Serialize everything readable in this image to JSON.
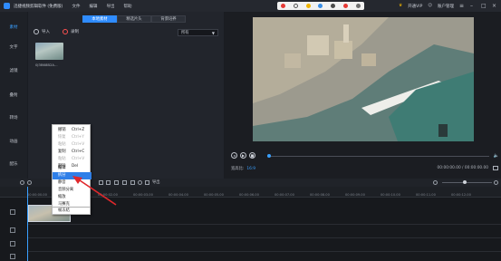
{
  "app": {
    "title": "迅捷视频剪辑软件 (免费版)",
    "menus": [
      "文件",
      "编辑",
      "导出",
      "帮助"
    ],
    "vip_label": "开通VIP",
    "account_label": "账户管理"
  },
  "sidebar": {
    "items": [
      {
        "label": "素材",
        "active": true
      },
      {
        "label": "文字",
        "active": false
      },
      {
        "label": "滤镜",
        "active": false
      },
      {
        "label": "叠附",
        "active": false
      },
      {
        "label": "转场",
        "active": false
      },
      {
        "label": "动画",
        "active": false
      },
      {
        "label": "配乐",
        "active": false
      }
    ]
  },
  "media": {
    "tabs": [
      {
        "label": "本地素材",
        "active": true
      },
      {
        "label": "精选片头",
        "active": false
      },
      {
        "label": "背景培养",
        "active": false
      }
    ],
    "import_label": "导入",
    "record_label": "录制",
    "filter_value": "所有",
    "thumb_label": "0J3B68B2A..."
  },
  "preview": {
    "ratio_label": "宽高比:",
    "ratio_value": "16:9",
    "time": "00:00:00.00 / 00:00:00.00"
  },
  "timeline": {
    "export_label": "导出",
    "ticks": [
      "00:00:00.00",
      "00:00:01.00",
      "00:00:02.00",
      "00:00:03.00",
      "00:00:04.00",
      "00:00:05.00",
      "00:00:06.00",
      "00:00:07.00",
      "00:00:08.00",
      "00:00:09.00",
      "00:00:10.00",
      "00:00:11.00",
      "00:00:12.00"
    ]
  },
  "context_menu": {
    "items": [
      {
        "label": "撤销",
        "shortcut": "Ctrl+Z",
        "disabled": false
      },
      {
        "label": "恢复",
        "shortcut": "Ctrl+Y",
        "disabled": true
      },
      {
        "label": "粘贴",
        "shortcut": "Ctrl+V",
        "disabled": true
      },
      {
        "label": "复制",
        "shortcut": "Ctrl+C",
        "disabled": false
      },
      {
        "label": "粘贴",
        "shortcut": "Ctrl+V",
        "disabled": true
      },
      {
        "label": "删除",
        "shortcut": "Del",
        "disabled": false
      },
      {
        "label": "编辑",
        "shortcut": "",
        "disabled": false
      },
      {
        "label": "拆分",
        "shortcut": "",
        "disabled": false,
        "highlighted": true
      },
      {
        "label": "静音",
        "shortcut": "",
        "disabled": false
      },
      {
        "label": "音频分离",
        "shortcut": "",
        "disabled": false
      },
      {
        "label": "缩放",
        "shortcut": "",
        "disabled": false
      },
      {
        "label": "马赛克",
        "shortcut": "",
        "disabled": false
      },
      {
        "label": "帧冻结",
        "shortcut": "",
        "disabled": false
      }
    ]
  },
  "colors": {
    "accent": "#2f8cff",
    "annotation_arrow": "#e0282c",
    "background": "#1a1c22"
  }
}
